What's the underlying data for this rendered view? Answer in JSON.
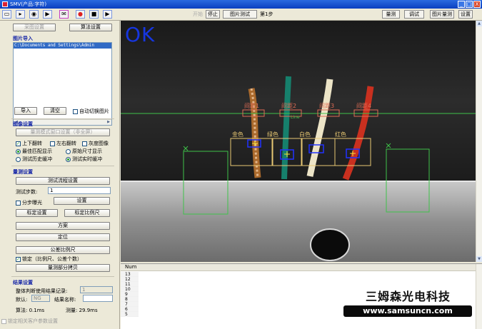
{
  "window": {
    "title": "SMV(产品:字符)",
    "minimize": "_",
    "maximize": "□",
    "close": "X"
  },
  "toolbar": {
    "start": "开始",
    "stop": "停止",
    "image_test": "图片测试",
    "step": "第1步",
    "measure": "量测",
    "debug": "调试",
    "image_measure": "图片量测",
    "settings": "设置"
  },
  "image_import": {
    "heading": "图片导入",
    "capture_settings": "采图设置",
    "algorithm_settings": "算法设置",
    "file_path": "C:\\Documents and Settings\\Admin",
    "import_button": "导入",
    "clear_button": "清空",
    "auto_switch": "自动切换图片"
  },
  "image_settings": {
    "heading": "图像设置",
    "window_settings": "量测模式窗口设置（非全屏）",
    "flip_vertical": "上下翻转",
    "flip_horizontal": "左右翻转",
    "grayscale": "灰度图像",
    "best_fit": "最佳匹配显示",
    "original_size": "原始尺寸显示",
    "test_history_buffer": "测试历史缓冲",
    "test_realtime_buffer": "测试实时缓冲"
  },
  "measure_settings": {
    "heading": "量测设置",
    "flow_settings": "测试流程设置",
    "step_label": "测试步数:",
    "step_value": "1",
    "step_exposure": "分步曝光",
    "set_button": "设置",
    "calibrate_settings": "标定设置",
    "calibrate_scale": "标定比例尺",
    "scheme": "方案",
    "locate": "定位",
    "tolerance_scale": "公差比例尺",
    "lock": "锁定（比例尺、公差个数）",
    "copy_part": "量测部分拷贝"
  },
  "result_settings": {
    "heading": "结果设置",
    "judge_label": "整体判断使用结果记录:",
    "judge_value": "1",
    "default_label": "默认:",
    "default_value": "NG",
    "result_name_label": "结果名称:",
    "result_name_value": "",
    "algorithm_time": "算法: 0.1ms",
    "measure_time": "测量: 29.9ms",
    "lock_customer": "锁定相关客户参数设置"
  },
  "image_view": {
    "status": "OK",
    "roi_labels": [
      "间距1",
      "间距2",
      "间距3",
      "间距4"
    ],
    "color_labels": [
      "金色",
      "绿色",
      "白色",
      "红色"
    ],
    "line_label": "Line"
  },
  "log": {
    "column": "Num",
    "rows": [
      "13",
      "12",
      "11",
      "10",
      "9",
      "8",
      "7",
      "6",
      "5"
    ]
  },
  "watermark": {
    "company": "三姆森光电科技",
    "url": "www.samsuncn.com"
  },
  "colors": {
    "status_ok": "#1636e0",
    "roi_outline": "#e06c55",
    "color_box": "#e8c873",
    "detect_box": "#2233ff",
    "guide_line": "#3fc24a"
  }
}
